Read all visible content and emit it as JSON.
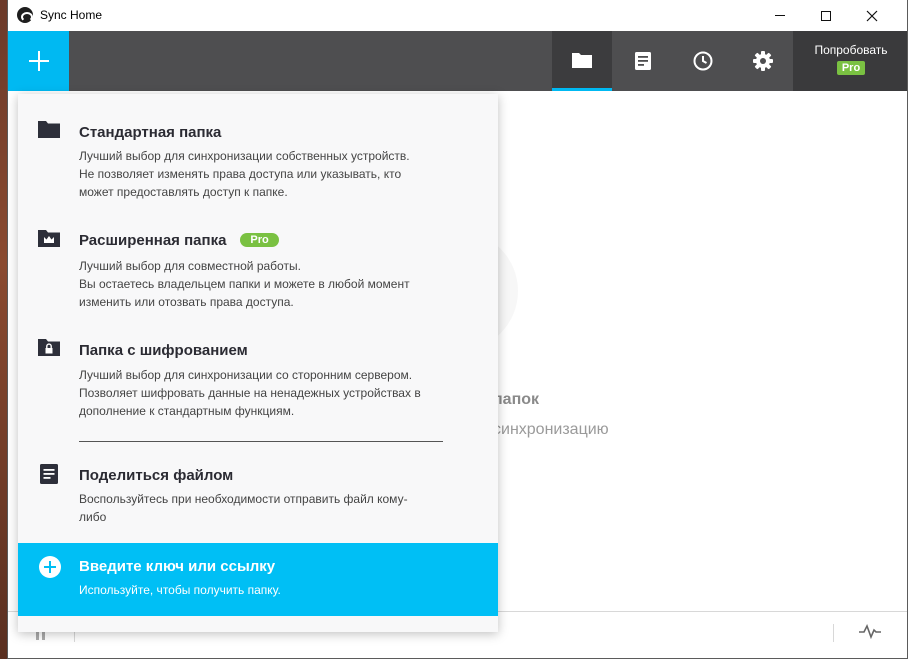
{
  "window": {
    "title": "Sync Home",
    "controls": {
      "minimize": "—",
      "maximize": "□",
      "close": "✕"
    }
  },
  "toolbar": {
    "add_icon": "plus-icon",
    "tabs": [
      {
        "name": "folders",
        "icon": "folder-icon",
        "active": true
      },
      {
        "name": "documents",
        "icon": "document-icon",
        "active": false
      },
      {
        "name": "history",
        "icon": "clock-icon",
        "active": false
      },
      {
        "name": "settings",
        "icon": "gear-icon",
        "active": false
      }
    ],
    "try_pro": {
      "label": "Попробовать",
      "badge": "Pro"
    }
  },
  "empty_state": {
    "title": "папок",
    "subtitle": "синхронизацию"
  },
  "add_menu": {
    "items": [
      {
        "icon": "folder-icon",
        "title": "Стандартная папка",
        "desc": [
          "Лучший выбор для синхронизации собственных устройств.",
          "Не позволяет изменять права доступа или указывать, кто",
          "может предоставлять доступ к папке."
        ]
      },
      {
        "icon": "crown-folder-icon",
        "title": "Расширенная папка",
        "badge": "Pro",
        "desc": [
          "Лучший выбор для совместной работы.",
          "Вы остаетесь владельцем папки и можете в любой момент",
          "изменить или отозвать права доступа."
        ]
      },
      {
        "icon": "lock-folder-icon",
        "title": "Папка с шифрованием",
        "desc": [
          "Лучший выбор для синхронизации со сторонним сервером.",
          "Позволяет шифровать данные на ненадежных устройствах в",
          "дополнение к стандартным функциям."
        ]
      },
      {
        "icon": "file-icon",
        "title": "Поделиться файлом",
        "desc": [
          "Воспользуйтесь при необходимости отправить файл кому-",
          "либо"
        ]
      }
    ],
    "key_item": {
      "icon": "plus-circle-icon",
      "title": "Введите ключ или ссылку",
      "desc": "Используйте, чтобы получить папку."
    }
  },
  "colors": {
    "accent": "#00b9f2",
    "toolbar": "#4e4e50",
    "pro_green": "#7ac142"
  }
}
